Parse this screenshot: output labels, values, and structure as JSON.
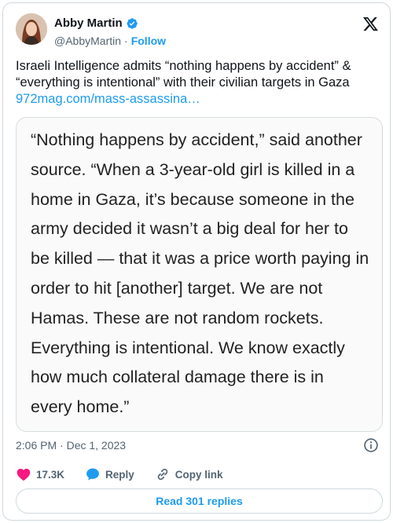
{
  "author": {
    "name": "Abby Martin",
    "handle": "@AbbyMartin",
    "separator": "·",
    "follow_label": "Follow"
  },
  "tweet": {
    "text": "Israeli Intelligence admits “nothing happens by accident” & “everything is intentional” with their civilian targets in Gaza ",
    "link_text": "972mag.com/mass-assassina…"
  },
  "quote_image_text": "“Nothing happens by accident,” said another source. “When a 3-year-old girl is killed in a home in Gaza, it’s because someone in the army decided it wasn’t a big deal for her to be killed — that it was a price worth paying in order to hit [another] target. We are not Hamas. These are not random rockets. Everything is intentional. We know exactly how much collateral damage there is in every home.”",
  "timestamp": "2:06 PM · Dec 1, 2023",
  "actions": {
    "like_count": "17.3K",
    "reply_label": "Reply",
    "copy_link_label": "Copy link"
  },
  "read_replies_label": "Read 301 replies",
  "icons": {
    "verified": "verified-badge-icon",
    "logo": "x-logo-icon",
    "info": "info-icon",
    "like": "heart-icon",
    "reply": "speech-bubble-icon",
    "copy": "link-icon"
  },
  "colors": {
    "accent": "#1d9bf0",
    "like": "#f91880",
    "muted": "#536471",
    "border": "#cfd9de"
  }
}
